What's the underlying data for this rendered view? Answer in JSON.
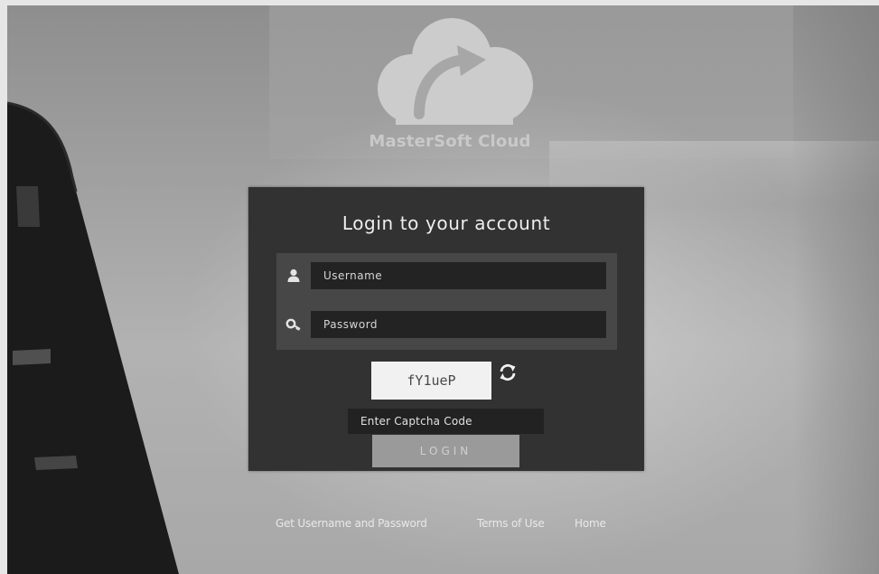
{
  "brand": {
    "name": "MasterSoft Cloud",
    "logo_icon": "cloud-sync-icon"
  },
  "login": {
    "title": "Login to your account",
    "username_placeholder": "Username",
    "username_icon": "user-icon",
    "password_placeholder": "Password",
    "password_icon": "key-icon",
    "captcha_code": "fY1ueP",
    "refresh_icon": "refresh-icon",
    "captcha_placeholder": "Enter Captcha Code",
    "login_label": "LOGIN"
  },
  "footer": {
    "links": [
      "Get Username and Password",
      "Terms of Use",
      "Home"
    ]
  },
  "colors": {
    "panel": "#323232",
    "field_group": "#474747",
    "input": "#232323",
    "captcha_bg": "#f1f1f1",
    "login_button": "#9a9a9a"
  }
}
